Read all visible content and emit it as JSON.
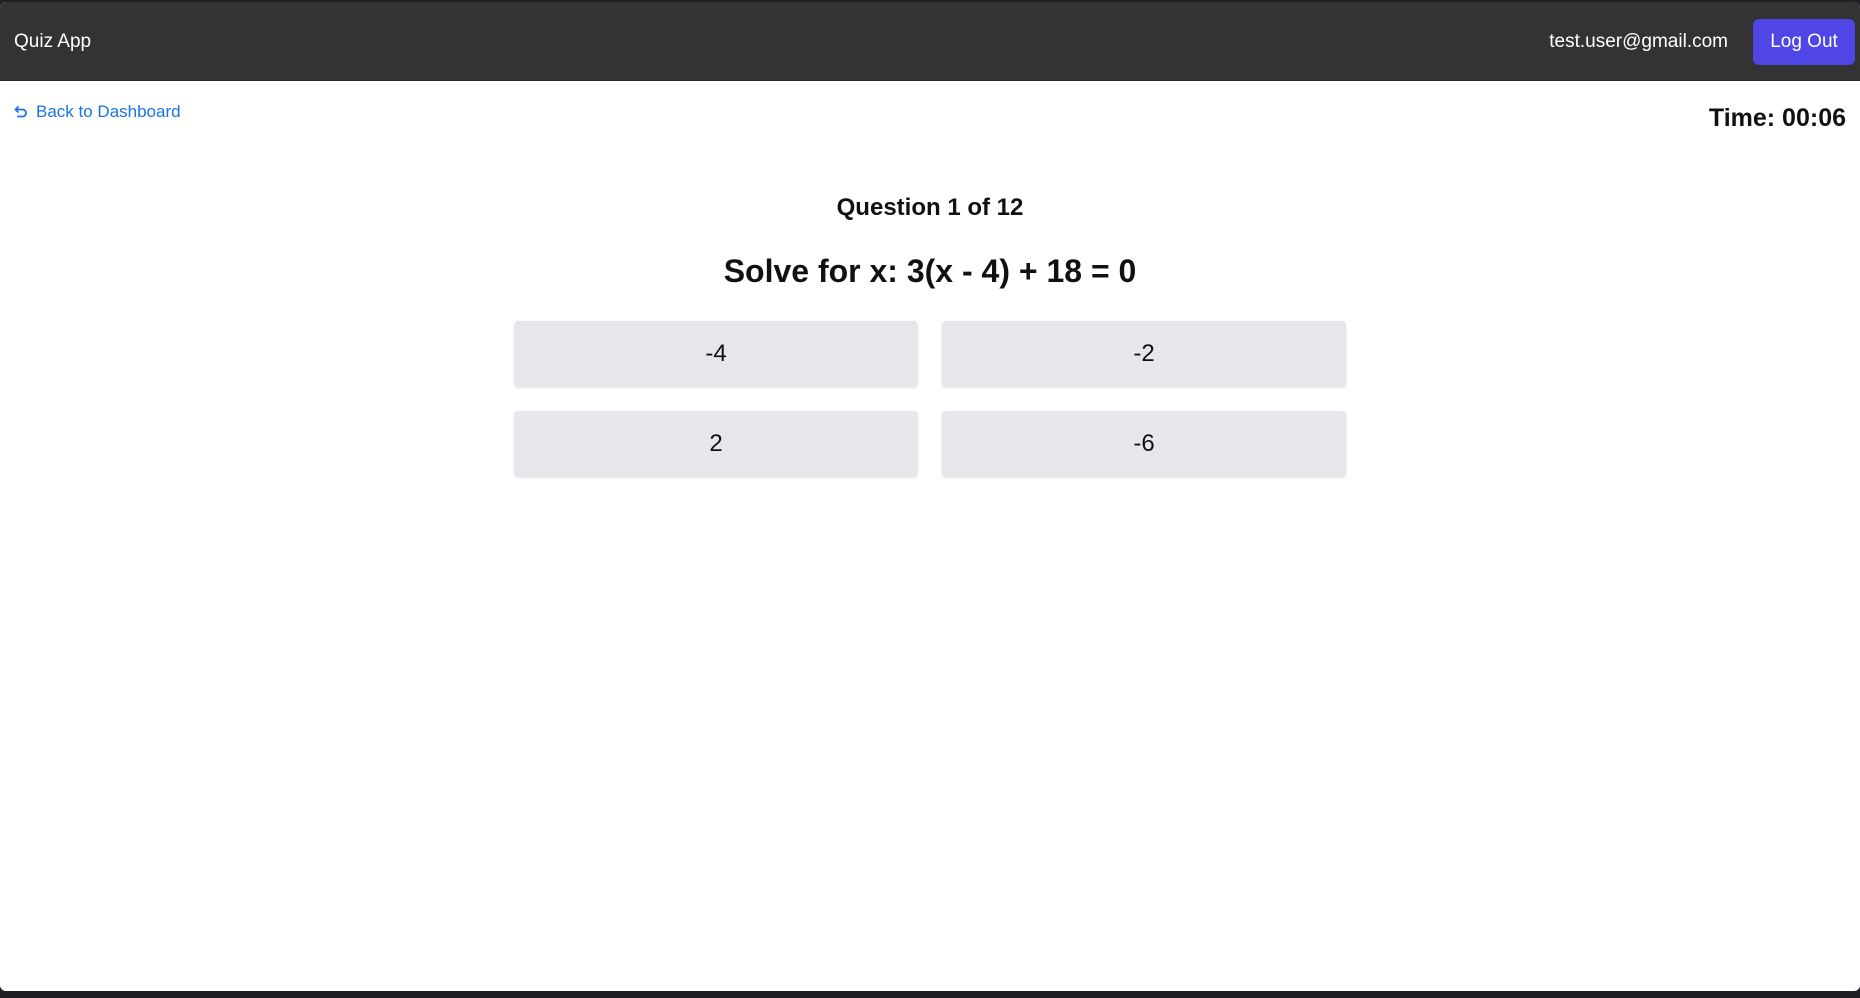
{
  "navbar": {
    "brand": "Quiz App",
    "user_email": "test.user@gmail.com",
    "logout_label": "Log Out"
  },
  "back_link": {
    "label": "Back to Dashboard",
    "icon": "undo-arrow-icon"
  },
  "timer": {
    "label": "Time: 00:06"
  },
  "question": {
    "counter": "Question 1 of 12",
    "text": "Solve for x: 3(x - 4) + 18 = 0"
  },
  "answers": [
    {
      "label": "-4"
    },
    {
      "label": "-2"
    },
    {
      "label": "2"
    },
    {
      "label": "-6"
    }
  ],
  "colors": {
    "navbar_bg": "#333333",
    "accent": "#4f46e5",
    "link": "#1a73e8",
    "answer_bg": "#e5e7eb"
  }
}
